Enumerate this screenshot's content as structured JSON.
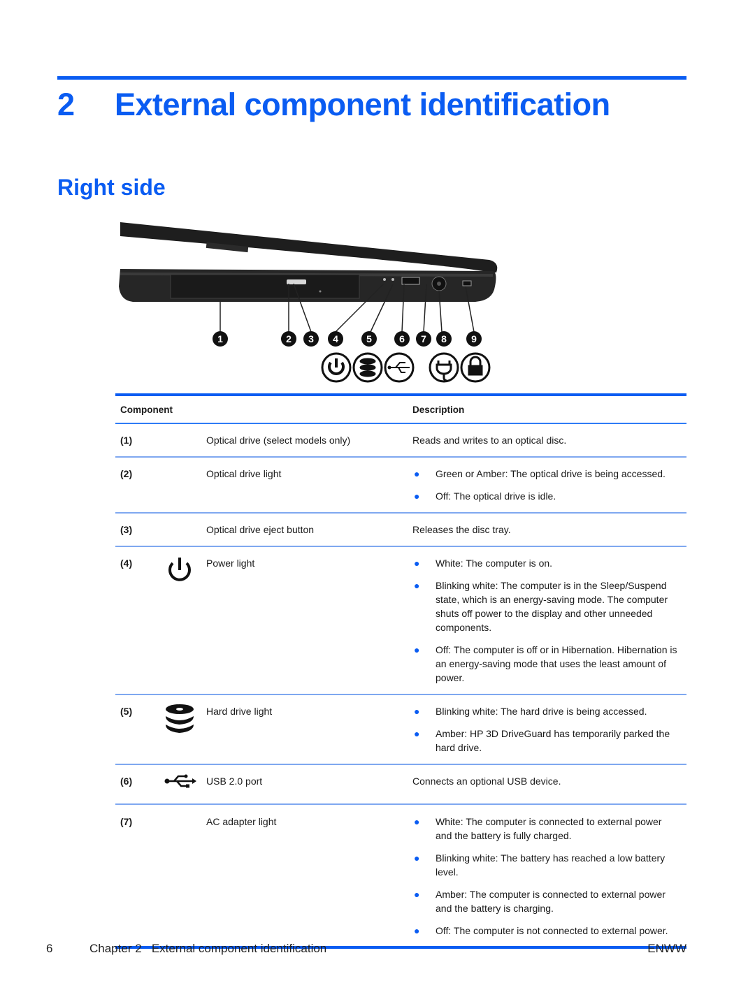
{
  "chapter": {
    "number": "2",
    "title": "External component identification"
  },
  "section": {
    "title": "Right side"
  },
  "figure": {
    "callouts": [
      "1",
      "2",
      "3",
      "4",
      "5",
      "6",
      "7",
      "8",
      "9"
    ],
    "legend_icons": [
      "power-icon",
      "hard-drive-icon",
      "usb-icon",
      "ac-adapter-icon",
      "lock-icon"
    ]
  },
  "table": {
    "headers": {
      "component": "Component",
      "description": "Description"
    },
    "rows": [
      {
        "num": "(1)",
        "icon": "",
        "name": "Optical drive (select models only)",
        "description": "Reads and writes to an optical disc."
      },
      {
        "num": "(2)",
        "icon": "",
        "name": "Optical drive light",
        "bullets": [
          "Green or Amber: The optical drive is being accessed.",
          "Off: The optical drive is idle."
        ]
      },
      {
        "num": "(3)",
        "icon": "",
        "name": "Optical drive eject button",
        "description": "Releases the disc tray."
      },
      {
        "num": "(4)",
        "icon": "power-icon",
        "name": "Power light",
        "bullets": [
          "White: The computer is on.",
          "Blinking white: The computer is in the Sleep/Suspend state, which is an energy-saving mode. The computer shuts off power to the display and other unneeded components.",
          "Off: The computer is off or in Hibernation. Hibernation is an energy-saving mode that uses the least amount of power."
        ]
      },
      {
        "num": "(5)",
        "icon": "hard-drive-icon",
        "name": "Hard drive light",
        "bullets": [
          "Blinking white: The hard drive is being accessed.",
          "Amber: HP 3D DriveGuard has temporarily parked the hard drive."
        ]
      },
      {
        "num": "(6)",
        "icon": "usb-icon",
        "name": "USB 2.0 port",
        "description": "Connects an optional USB device."
      },
      {
        "num": "(7)",
        "icon": "",
        "name": "AC adapter light",
        "bullets": [
          "White: The computer is connected to external power and the battery is fully charged.",
          "Blinking white: The battery has reached a low battery level.",
          "Amber: The computer is connected to external power and the battery is charging.",
          "Off: The computer is not connected to external power."
        ]
      }
    ]
  },
  "footer": {
    "page_number": "6",
    "chapter_label": "Chapter 2   External component identification",
    "locale": "ENWW"
  },
  "colors": {
    "accent": "#0a5cf2",
    "text": "#1a1a1a"
  }
}
